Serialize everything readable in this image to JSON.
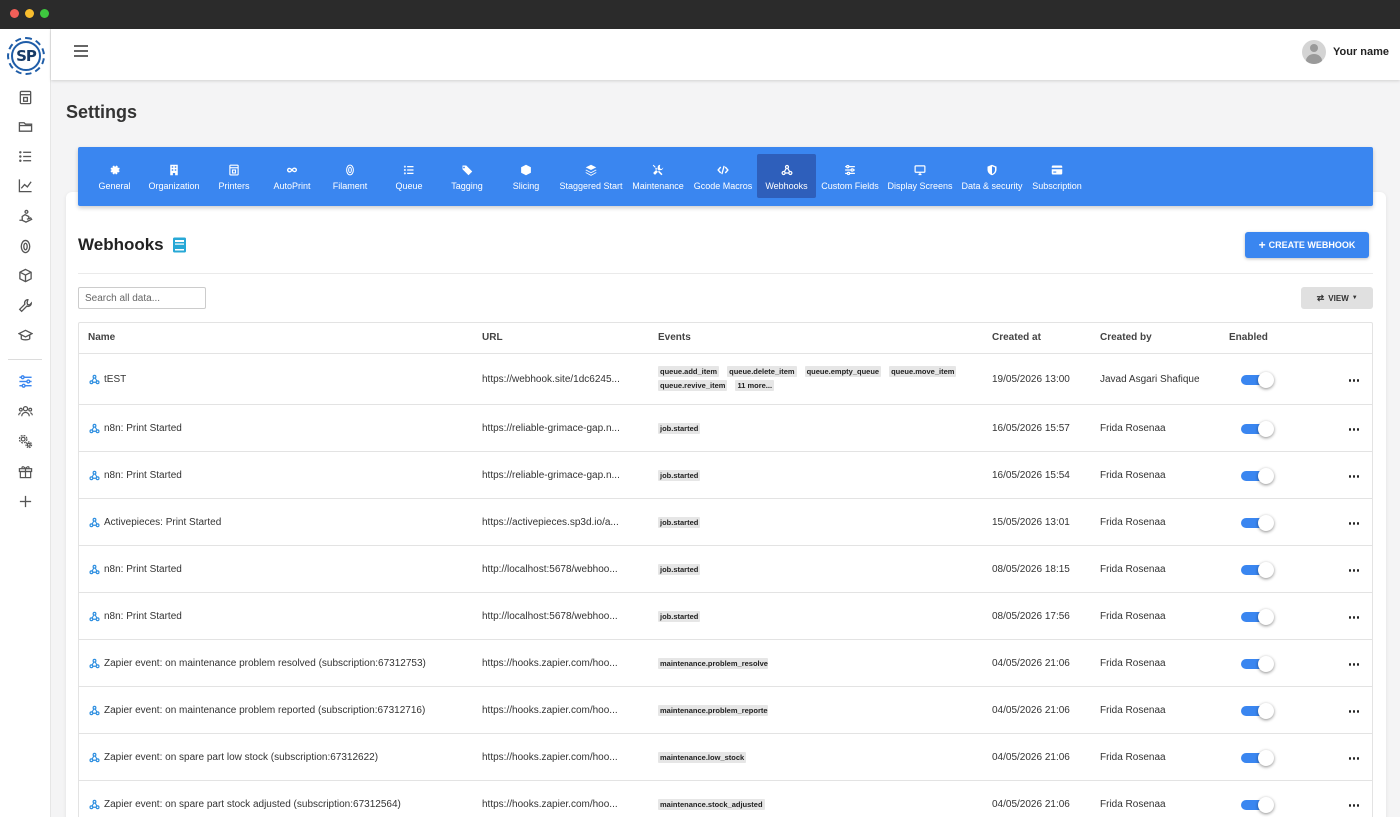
{
  "header": {
    "user_name": "Your name"
  },
  "page": {
    "title": "Settings"
  },
  "tabs": [
    {
      "label": "General",
      "icon": "gear-icon"
    },
    {
      "label": "Organization",
      "icon": "building-icon"
    },
    {
      "label": "Printers",
      "icon": "printer-icon"
    },
    {
      "label": "AutoPrint",
      "icon": "infinity-icon"
    },
    {
      "label": "Filament",
      "icon": "filament-icon"
    },
    {
      "label": "Queue",
      "icon": "list-icon"
    },
    {
      "label": "Tagging",
      "icon": "tag-icon"
    },
    {
      "label": "Slicing",
      "icon": "cube-icon"
    },
    {
      "label": "Staggered Start",
      "icon": "layers-icon"
    },
    {
      "label": "Maintenance",
      "icon": "tools-icon"
    },
    {
      "label": "Gcode Macros",
      "icon": "code-icon"
    },
    {
      "label": "Webhooks",
      "icon": "webhook-icon",
      "active": true
    },
    {
      "label": "Custom Fields",
      "icon": "sliders-icon"
    },
    {
      "label": "Display Screens",
      "icon": "monitor-icon"
    },
    {
      "label": "Data & security",
      "icon": "shield-icon"
    },
    {
      "label": "Subscription",
      "icon": "credit-card-icon"
    }
  ],
  "section": {
    "title": "Webhooks",
    "create_label": "CREATE WEBHOOK"
  },
  "search": {
    "placeholder": "Search all data..."
  },
  "view_label": "VIEW",
  "table": {
    "columns": [
      "Name",
      "URL",
      "Events",
      "Created at",
      "Created by",
      "Enabled"
    ],
    "rows": [
      {
        "name": "tEST",
        "url": "https://webhook.site/1dc6245...",
        "events": [
          "queue.add_item",
          "queue.delete_item",
          "queue.empty_queue",
          "queue.move_item",
          "queue.revive_item",
          "11 more..."
        ],
        "created_at": "19/05/2026 13:00",
        "created_by": "Javad Asgari Shafique",
        "enabled": true
      },
      {
        "name": "n8n: Print Started",
        "url": "https://reliable-grimace-gap.n...",
        "events": [
          "job.started"
        ],
        "created_at": "16/05/2026 15:57",
        "created_by": "Frida Rosenaa",
        "enabled": true
      },
      {
        "name": "n8n: Print Started",
        "url": "https://reliable-grimace-gap.n...",
        "events": [
          "job.started"
        ],
        "created_at": "16/05/2026 15:54",
        "created_by": "Frida Rosenaa",
        "enabled": true
      },
      {
        "name": "Activepieces: Print Started",
        "url": "https://activepieces.sp3d.io/a...",
        "events": [
          "job.started"
        ],
        "created_at": "15/05/2026 13:01",
        "created_by": "Frida Rosenaa",
        "enabled": true
      },
      {
        "name": "n8n: Print Started",
        "url": "http://localhost:5678/webhoo...",
        "events": [
          "job.started"
        ],
        "created_at": "08/05/2026 18:15",
        "created_by": "Frida Rosenaa",
        "enabled": true
      },
      {
        "name": "n8n: Print Started",
        "url": "http://localhost:5678/webhoo...",
        "events": [
          "job.started"
        ],
        "created_at": "08/05/2026 17:56",
        "created_by": "Frida Rosenaa",
        "enabled": true
      },
      {
        "name": "Zapier event: on maintenance problem resolved (subscription:67312753)",
        "url": "https://hooks.zapier.com/hoo...",
        "events": [
          "maintenance.problem_resolve"
        ],
        "created_at": "04/05/2026 21:06",
        "created_by": "Frida Rosenaa",
        "enabled": true
      },
      {
        "name": "Zapier event: on maintenance problem reported (subscription:67312716)",
        "url": "https://hooks.zapier.com/hoo...",
        "events": [
          "maintenance.problem_reporte"
        ],
        "created_at": "04/05/2026 21:06",
        "created_by": "Frida Rosenaa",
        "enabled": true
      },
      {
        "name": "Zapier event: on spare part low stock (subscription:67312622)",
        "url": "https://hooks.zapier.com/hoo...",
        "events": [
          "maintenance.low_stock"
        ],
        "created_at": "04/05/2026 21:06",
        "created_by": "Frida Rosenaa",
        "enabled": true
      },
      {
        "name": "Zapier event: on spare part stock adjusted (subscription:67312564)",
        "url": "https://hooks.zapier.com/hoo...",
        "events": [
          "maintenance.stock_adjusted"
        ],
        "created_at": "04/05/2026 21:06",
        "created_by": "Frida Rosenaa",
        "enabled": true
      }
    ]
  },
  "colors": {
    "accent": "#3a86f0",
    "active_tab": "#2e5fbb",
    "webhook_icon": "#2f8fe0"
  }
}
